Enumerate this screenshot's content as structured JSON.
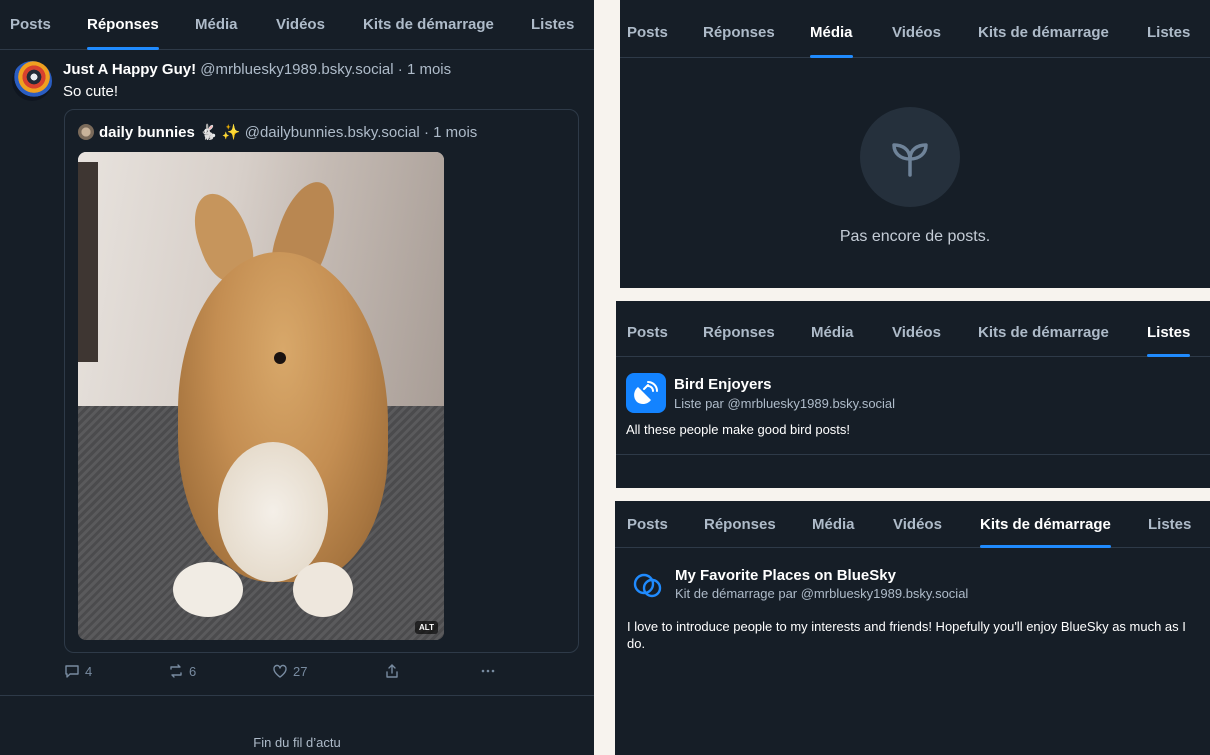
{
  "tabs": {
    "posts": "Posts",
    "replies": "Réponses",
    "media": "Média",
    "videos": "Vidéos",
    "starter_kits": "Kits de démarrage",
    "lists": "Listes"
  },
  "replies_panel": {
    "active_tab": "Réponses",
    "post": {
      "author_name": "Just A Happy Guy!",
      "handle": "@mrbluesky1989.bsky.social",
      "separator": "·",
      "time": "1 mois",
      "text": "So cute!",
      "quote": {
        "author_name": "daily bunnies 🐇 ✨",
        "handle": "@dailybunnies.bsky.social",
        "separator": "·",
        "time": "1 mois",
        "image_alt_badge": "ALT"
      },
      "actions": {
        "replies": "4",
        "reposts": "6",
        "likes": "27"
      }
    },
    "end_of_feed": "Fin du fil d’actu"
  },
  "media_panel": {
    "active_tab": "Média",
    "empty_icon": "seedling-icon",
    "empty_text": "Pas encore de posts."
  },
  "lists_panel": {
    "active_tab": "Listes",
    "list": {
      "icon": "satellite-dish-icon",
      "title": "Bird Enjoyers",
      "subtitle": "Liste par @mrbluesky1989.bsky.social",
      "description": "All these people make good bird posts!"
    }
  },
  "kits_panel": {
    "active_tab": "Kits de démarrage",
    "kit": {
      "icon": "starter-kit-icon",
      "title": "My Favorite Places on BlueSky",
      "subtitle": "Kit de démarrage par @mrbluesky1989.bsky.social",
      "description": "I love to introduce people to my interests and friends! Hopefully you'll enjoy BlueSky as much as I do."
    }
  },
  "colors": {
    "background": "#161e27",
    "accent": "#208bfe",
    "border": "#2e3a48",
    "muted_text": "#aebbc9"
  }
}
